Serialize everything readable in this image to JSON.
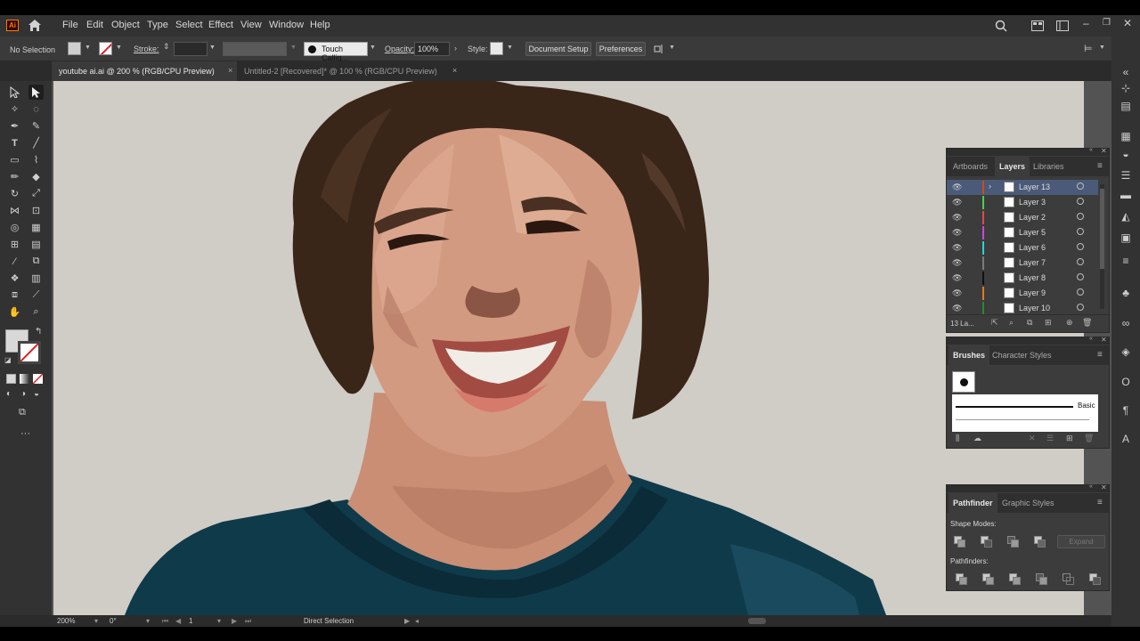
{
  "menu": [
    "File",
    "Edit",
    "Object",
    "Type",
    "Select",
    "Effect",
    "View",
    "Window",
    "Help"
  ],
  "app_logo": "Ai",
  "control": {
    "selection": "No Selection",
    "stroke_label": "Stroke:",
    "brush_name": "Touch Callig...",
    "opacity_label": "Opacity:",
    "opacity_value": "100%",
    "style_label": "Style:",
    "doc_setup": "Document Setup",
    "preferences": "Preferences"
  },
  "tabs": [
    {
      "label": "youtube ai.ai @ 200 % (RGB/CPU Preview)",
      "close": "×"
    },
    {
      "label": "Untitled-2 [Recovered]* @ 100 % (RGB/CPU Preview)",
      "close": "×"
    }
  ],
  "layers_panel": {
    "tabs": [
      "Artboards",
      "Layers",
      "Libraries"
    ],
    "layers": [
      {
        "name": "Layer 13",
        "color": "#d24a1c"
      },
      {
        "name": "Layer 3",
        "color": "#4ad24a"
      },
      {
        "name": "Layer 2",
        "color": "#e04a4a"
      },
      {
        "name": "Layer 5",
        "color": "#c84ad2"
      },
      {
        "name": "Layer 6",
        "color": "#2ad2d2"
      },
      {
        "name": "Layer 7",
        "color": "#7a7a7a"
      },
      {
        "name": "Layer 8",
        "color": "#111111"
      },
      {
        "name": "Layer 9",
        "color": "#e07a1c"
      },
      {
        "name": "Layer 10",
        "color": "#2a8a2a"
      }
    ],
    "count": "13 La..."
  },
  "brushes_panel": {
    "tabs": [
      "Brushes",
      "Character Styles"
    ],
    "basic_label": "Basic"
  },
  "pathfinder_panel": {
    "tabs": [
      "Pathfinder",
      "Graphic Styles"
    ],
    "shape_modes": "Shape Modes:",
    "pathfinders": "Pathfinders:",
    "expand": "Expand"
  },
  "status": {
    "zoom": "200%",
    "rotation": "0°",
    "artboard": "1",
    "tool": "Direct Selection"
  },
  "colors": {
    "ui_dark": "#323232",
    "canvas_bg": "#d0ccc6",
    "skin": "#c98e74",
    "hair": "#3a2519",
    "shirt": "#0f3a4a",
    "accent_logo": "#ff7c00"
  }
}
